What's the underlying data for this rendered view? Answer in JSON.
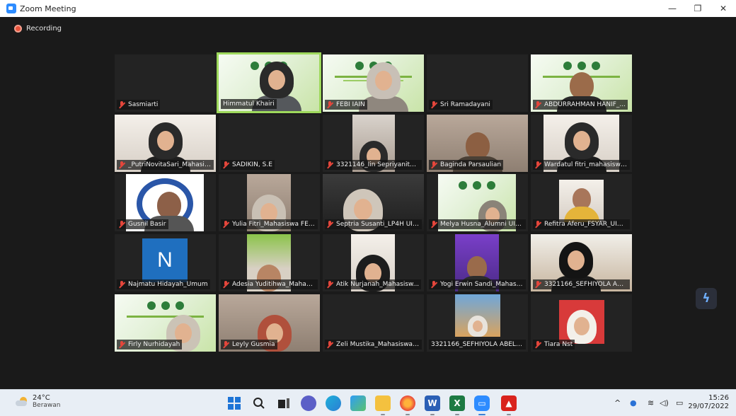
{
  "window": {
    "title": "Zoom Meeting",
    "minimize": "—",
    "restore": "❐",
    "close": "✕"
  },
  "meeting": {
    "recording_label": "Recording",
    "participants": [
      {
        "name": "Sasmiarti",
        "muted": true,
        "video": "off"
      },
      {
        "name": "Himmatul Khairi",
        "muted": false,
        "video": "on",
        "active_speaker": true
      },
      {
        "name": "FEBI IAIN",
        "muted": true,
        "video": "on"
      },
      {
        "name": "Sri Ramadayani",
        "muted": true,
        "video": "off"
      },
      {
        "name": "ABDURRAHMAN HANIF_...",
        "muted": true,
        "video": "on"
      },
      {
        "name": "_PutriNovitaSari_Mahasis...",
        "muted": true,
        "video": "on"
      },
      {
        "name": "SADIKIN, S.E",
        "muted": true,
        "video": "off"
      },
      {
        "name": "3321146_Iin Sepriyanita S...",
        "muted": true,
        "video": "on"
      },
      {
        "name": "Baginda Parsaulian",
        "muted": true,
        "video": "on"
      },
      {
        "name": "Wardatul fitri_mahasiswa...",
        "muted": true,
        "video": "on"
      },
      {
        "name": "Gusnil Basir",
        "muted": true,
        "video": "on"
      },
      {
        "name": "Yulia Fitri_Mahasiswa FEB...",
        "muted": true,
        "video": "on"
      },
      {
        "name": "Septria Susanti_LP4H UIN...",
        "muted": true,
        "video": "on"
      },
      {
        "name": "Melya Husna_Alumni UIN...",
        "muted": true,
        "video": "on"
      },
      {
        "name": "Refitra Aferu_FSYAR_UIN ...",
        "muted": true,
        "video": "on"
      },
      {
        "name": "Najmatu Hidayah_Umum",
        "muted": true,
        "video": "off",
        "initial": "N"
      },
      {
        "name": "Adesia Yuditihwa_Mahasi...",
        "muted": true,
        "video": "on"
      },
      {
        "name": "Atik Nurjanah_Mahasisw...",
        "muted": true,
        "video": "on"
      },
      {
        "name": "Yogi Erwin Sandi_Mahasi...",
        "muted": true,
        "video": "on"
      },
      {
        "name": "3321166_SEFHIYOLA ABE...",
        "muted": true,
        "video": "on"
      },
      {
        "name": "Firly Nurhidayah",
        "muted": true,
        "video": "on"
      },
      {
        "name": "Leyly Gusmia",
        "muted": true,
        "video": "on"
      },
      {
        "name": "Zeli Mustika_Mahasiswa ...",
        "muted": true,
        "video": "off"
      },
      {
        "name": "3321166_SEFHIYOLA ABELSA-",
        "muted": false,
        "video": "on"
      },
      {
        "name": "Tiara Nst",
        "muted": true,
        "video": "on"
      }
    ]
  },
  "taskbar": {
    "weather_temp": "24°C",
    "weather_condition": "Berawan",
    "apps": [
      "start-icon",
      "search-icon",
      "task-view-icon",
      "teams-chat-icon",
      "edge-icon",
      "photos-icon",
      "file-explorer-icon",
      "firefox-icon",
      "word-icon",
      "excel-icon",
      "zoom-icon",
      "acrobat-icon"
    ],
    "time": "15:26",
    "date": "29/07/2022"
  },
  "colors": {
    "active_speaker_border": "#9ed95c",
    "mute_red": "#e4463b",
    "zoom_blue": "#2d8cff"
  }
}
